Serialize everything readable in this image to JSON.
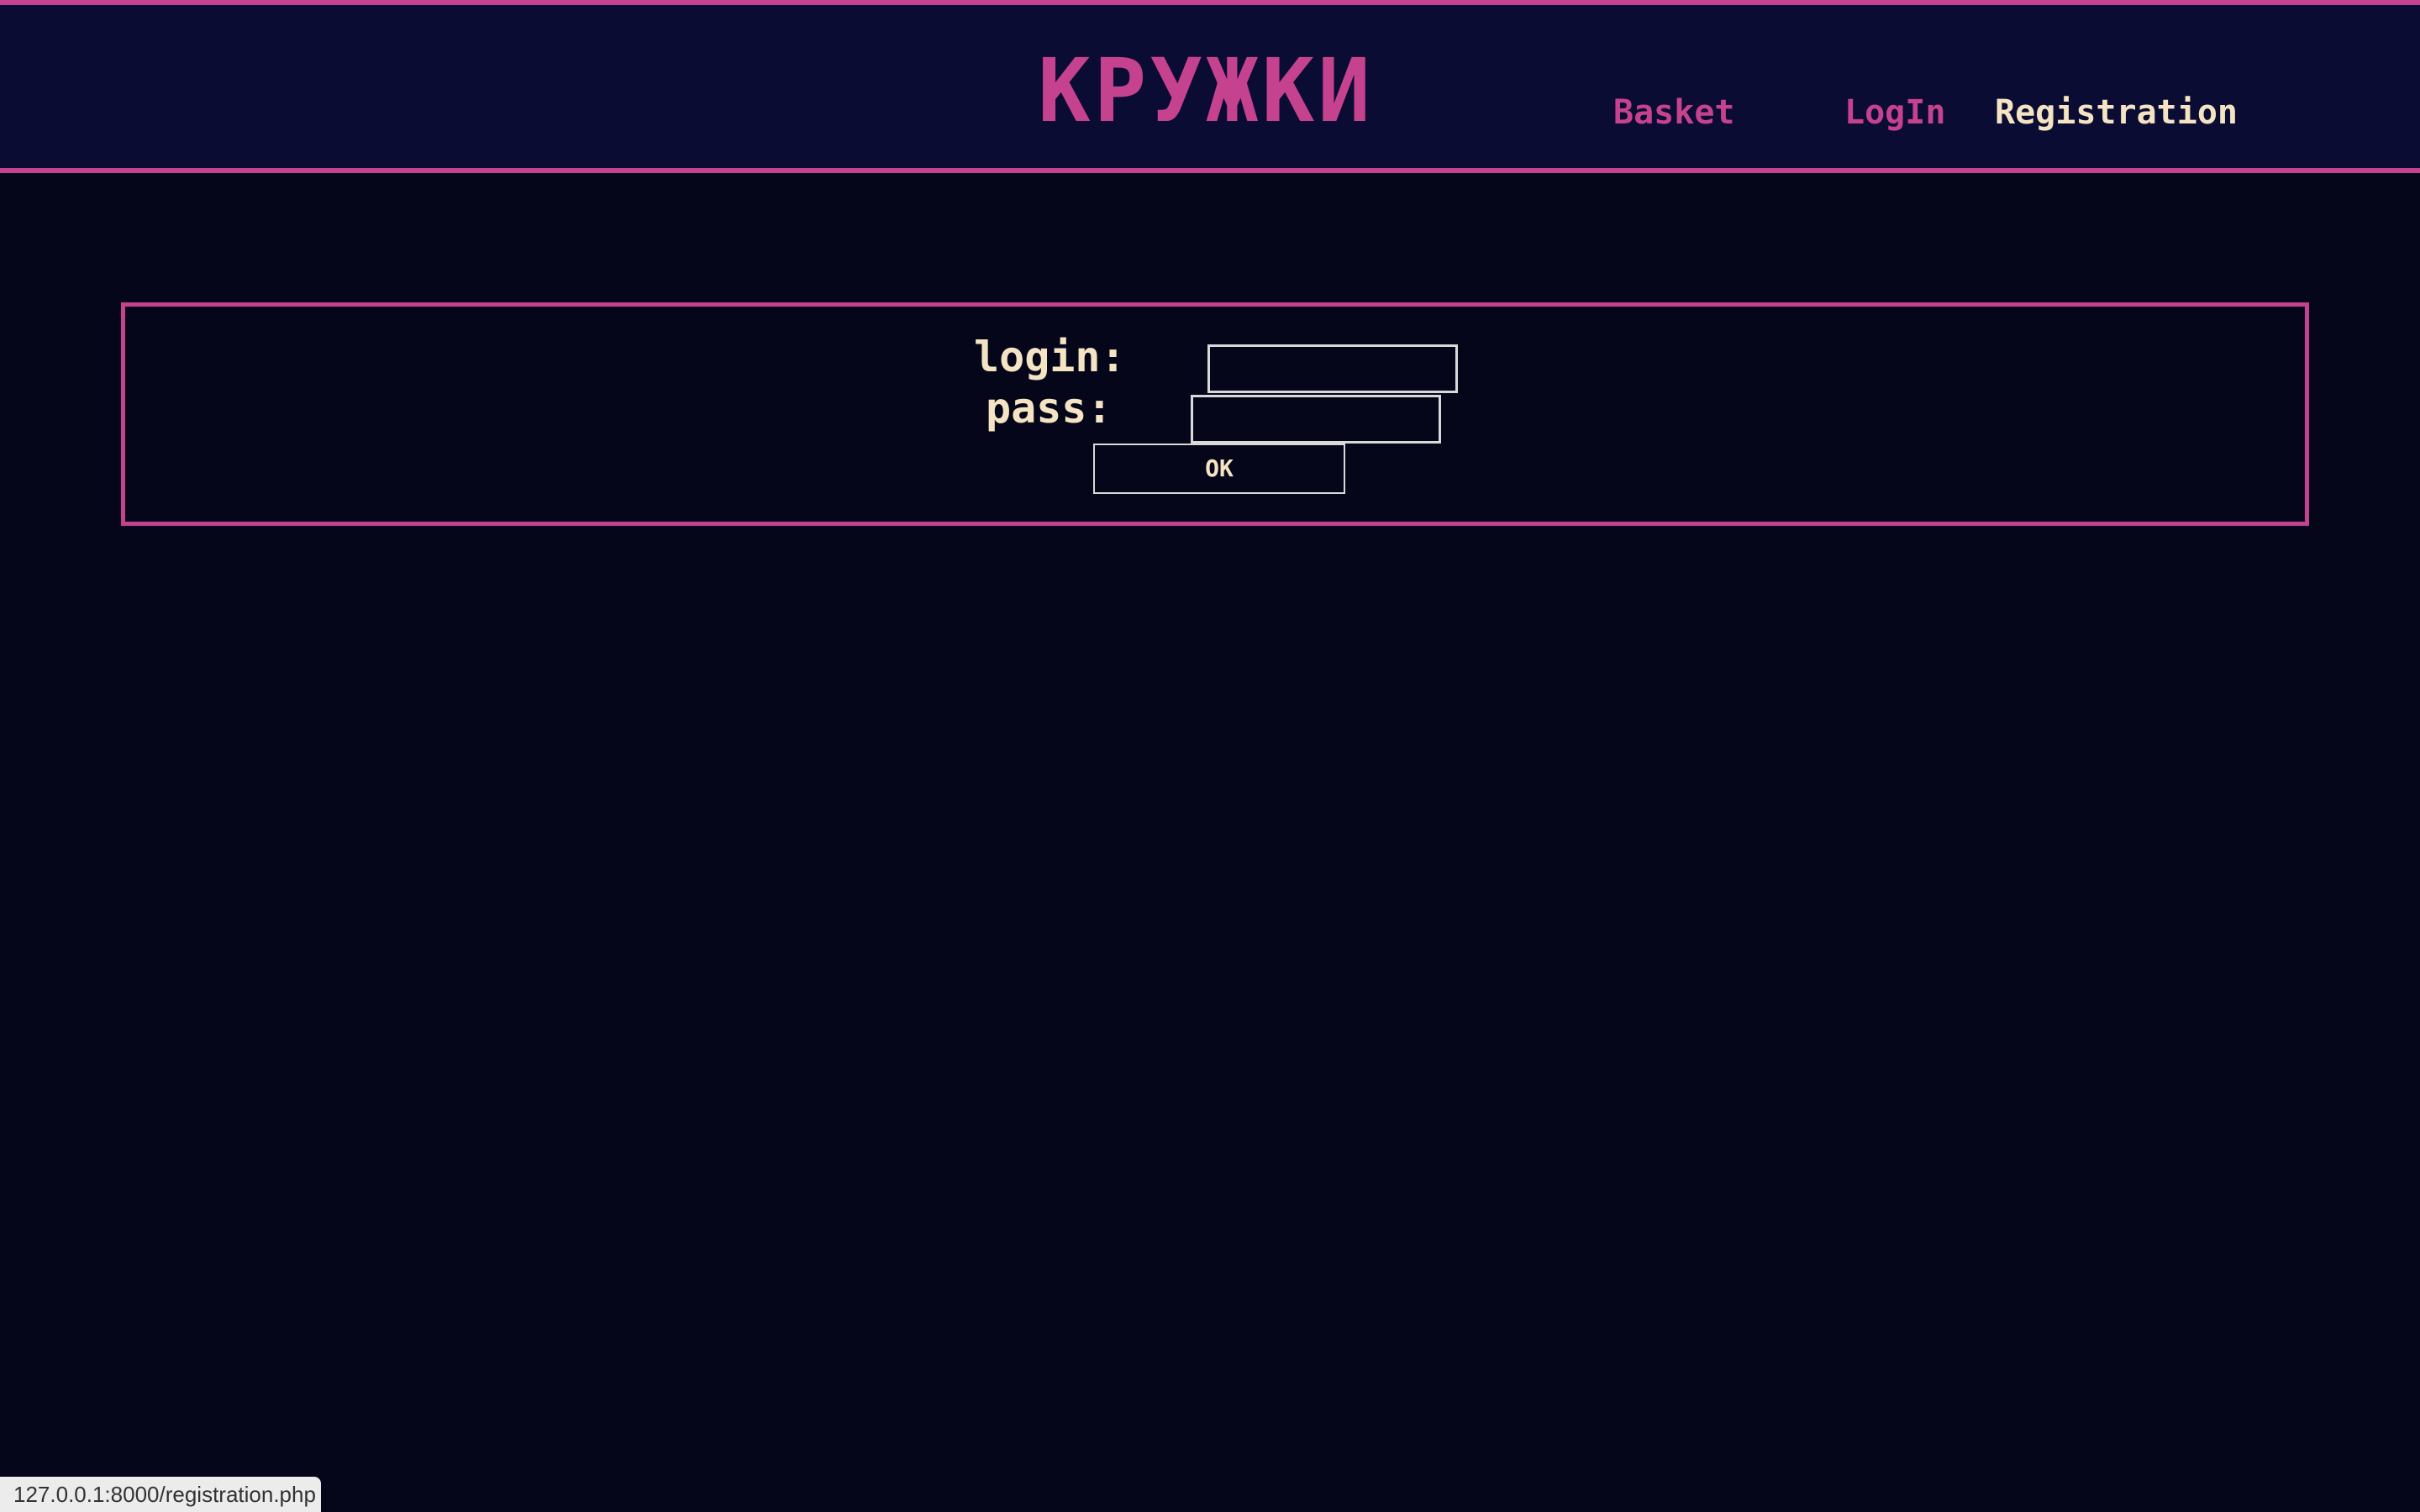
{
  "header": {
    "logo": "КРУЖКИ",
    "nav": {
      "basket": "Basket",
      "login": "LogIn",
      "registration": "Registration"
    }
  },
  "form": {
    "login_label": "login:",
    "pass_label": "pass:",
    "login_value": "",
    "pass_value": "",
    "submit_label": "OK"
  },
  "status_bar": {
    "url": "127.0.0.1:8000/registration.php"
  },
  "colors": {
    "accent": "#c5428f",
    "text_light": "#f5e4c3",
    "header_bg": "#0b0c33",
    "page_bg": "#06061a"
  }
}
